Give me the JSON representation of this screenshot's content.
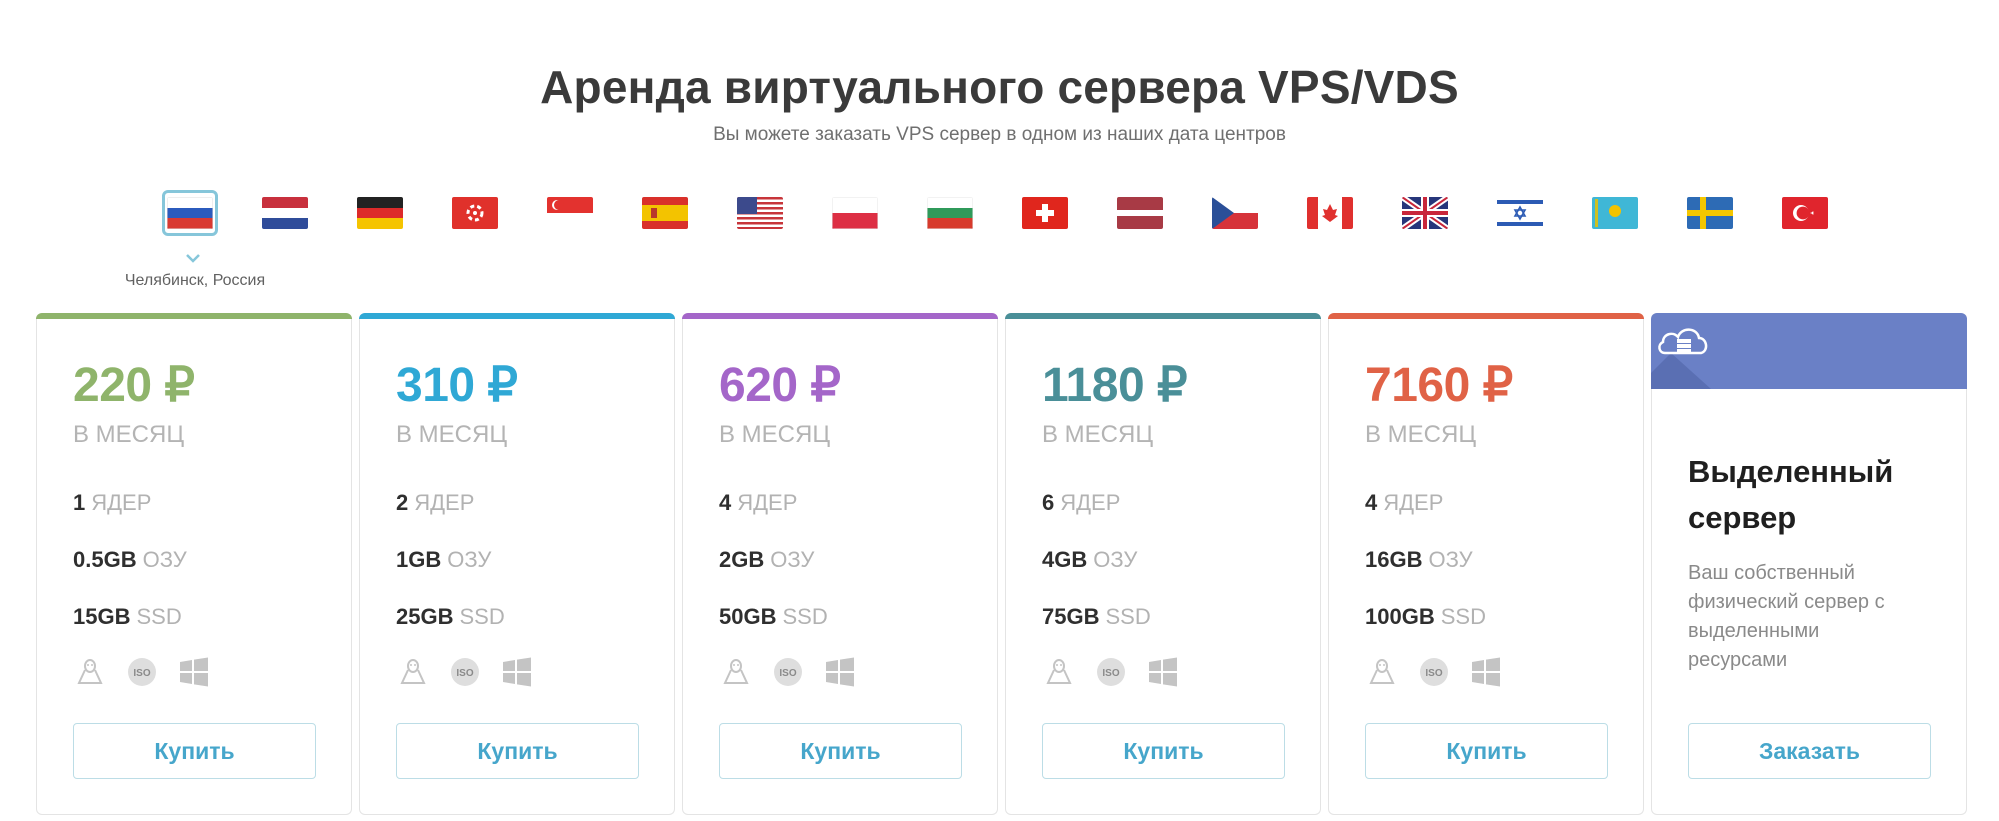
{
  "header": {
    "title": "Аренда виртуального сервера VPS/VDS",
    "subtitle": "Вы можете заказать VPS сервер в одном из наших дата центров"
  },
  "locations": {
    "selected_label": "Челябинск, Россия",
    "flags": [
      "russia-flag-icon",
      "netherlands-flag-icon",
      "germany-flag-icon",
      "hong-kong-flag-icon",
      "singapore-flag-icon",
      "spain-flag-icon",
      "usa-flag-icon",
      "poland-flag-icon",
      "bulgaria-flag-icon",
      "switzerland-flag-icon",
      "latvia-flag-icon",
      "czech-flag-icon",
      "canada-flag-icon",
      "uk-flag-icon",
      "israel-flag-icon",
      "kazakhstan-flag-icon",
      "sweden-flag-icon",
      "turkey-flag-icon"
    ]
  },
  "plans": [
    {
      "price": "220 ₽",
      "period": "В МЕСЯЦ",
      "cores": "1",
      "cores_unit": "ЯДЕР",
      "ram": "0.5GB",
      "ram_unit": "ОЗУ",
      "disk": "15GB",
      "disk_unit": "SSD",
      "button": "Купить",
      "accent": "#8fb46b"
    },
    {
      "price": "310 ₽",
      "period": "В МЕСЯЦ",
      "cores": "2",
      "cores_unit": "ЯДЕР",
      "ram": "1GB",
      "ram_unit": "ОЗУ",
      "disk": "25GB",
      "disk_unit": "SSD",
      "button": "Купить",
      "accent": "#2fa8d5"
    },
    {
      "price": "620 ₽",
      "period": "В МЕСЯЦ",
      "cores": "4",
      "cores_unit": "ЯДЕР",
      "ram": "2GB",
      "ram_unit": "ОЗУ",
      "disk": "50GB",
      "disk_unit": "SSD",
      "button": "Купить",
      "accent": "#a466c9"
    },
    {
      "price": "1180 ₽",
      "period": "В МЕСЯЦ",
      "cores": "6",
      "cores_unit": "ЯДЕР",
      "ram": "4GB",
      "ram_unit": "ОЗУ",
      "disk": "75GB",
      "disk_unit": "SSD",
      "button": "Купить",
      "accent": "#4a8f98"
    },
    {
      "price": "7160 ₽",
      "period": "В МЕСЯЦ",
      "cores": "4",
      "cores_unit": "ЯДЕР",
      "ram": "16GB",
      "ram_unit": "ОЗУ",
      "disk": "100GB",
      "disk_unit": "SSD",
      "button": "Купить",
      "accent": "#e06246"
    }
  ],
  "dedicated": {
    "title": "Выделенный сервер",
    "description": "Ваш собственный физический сервер с выделенными ресурсами",
    "button": "Заказать",
    "header_color": "#6a80c6",
    "icon": "cloud-server-icon"
  },
  "os_icons": [
    "linux-icon",
    "iso-icon",
    "windows-icon"
  ]
}
